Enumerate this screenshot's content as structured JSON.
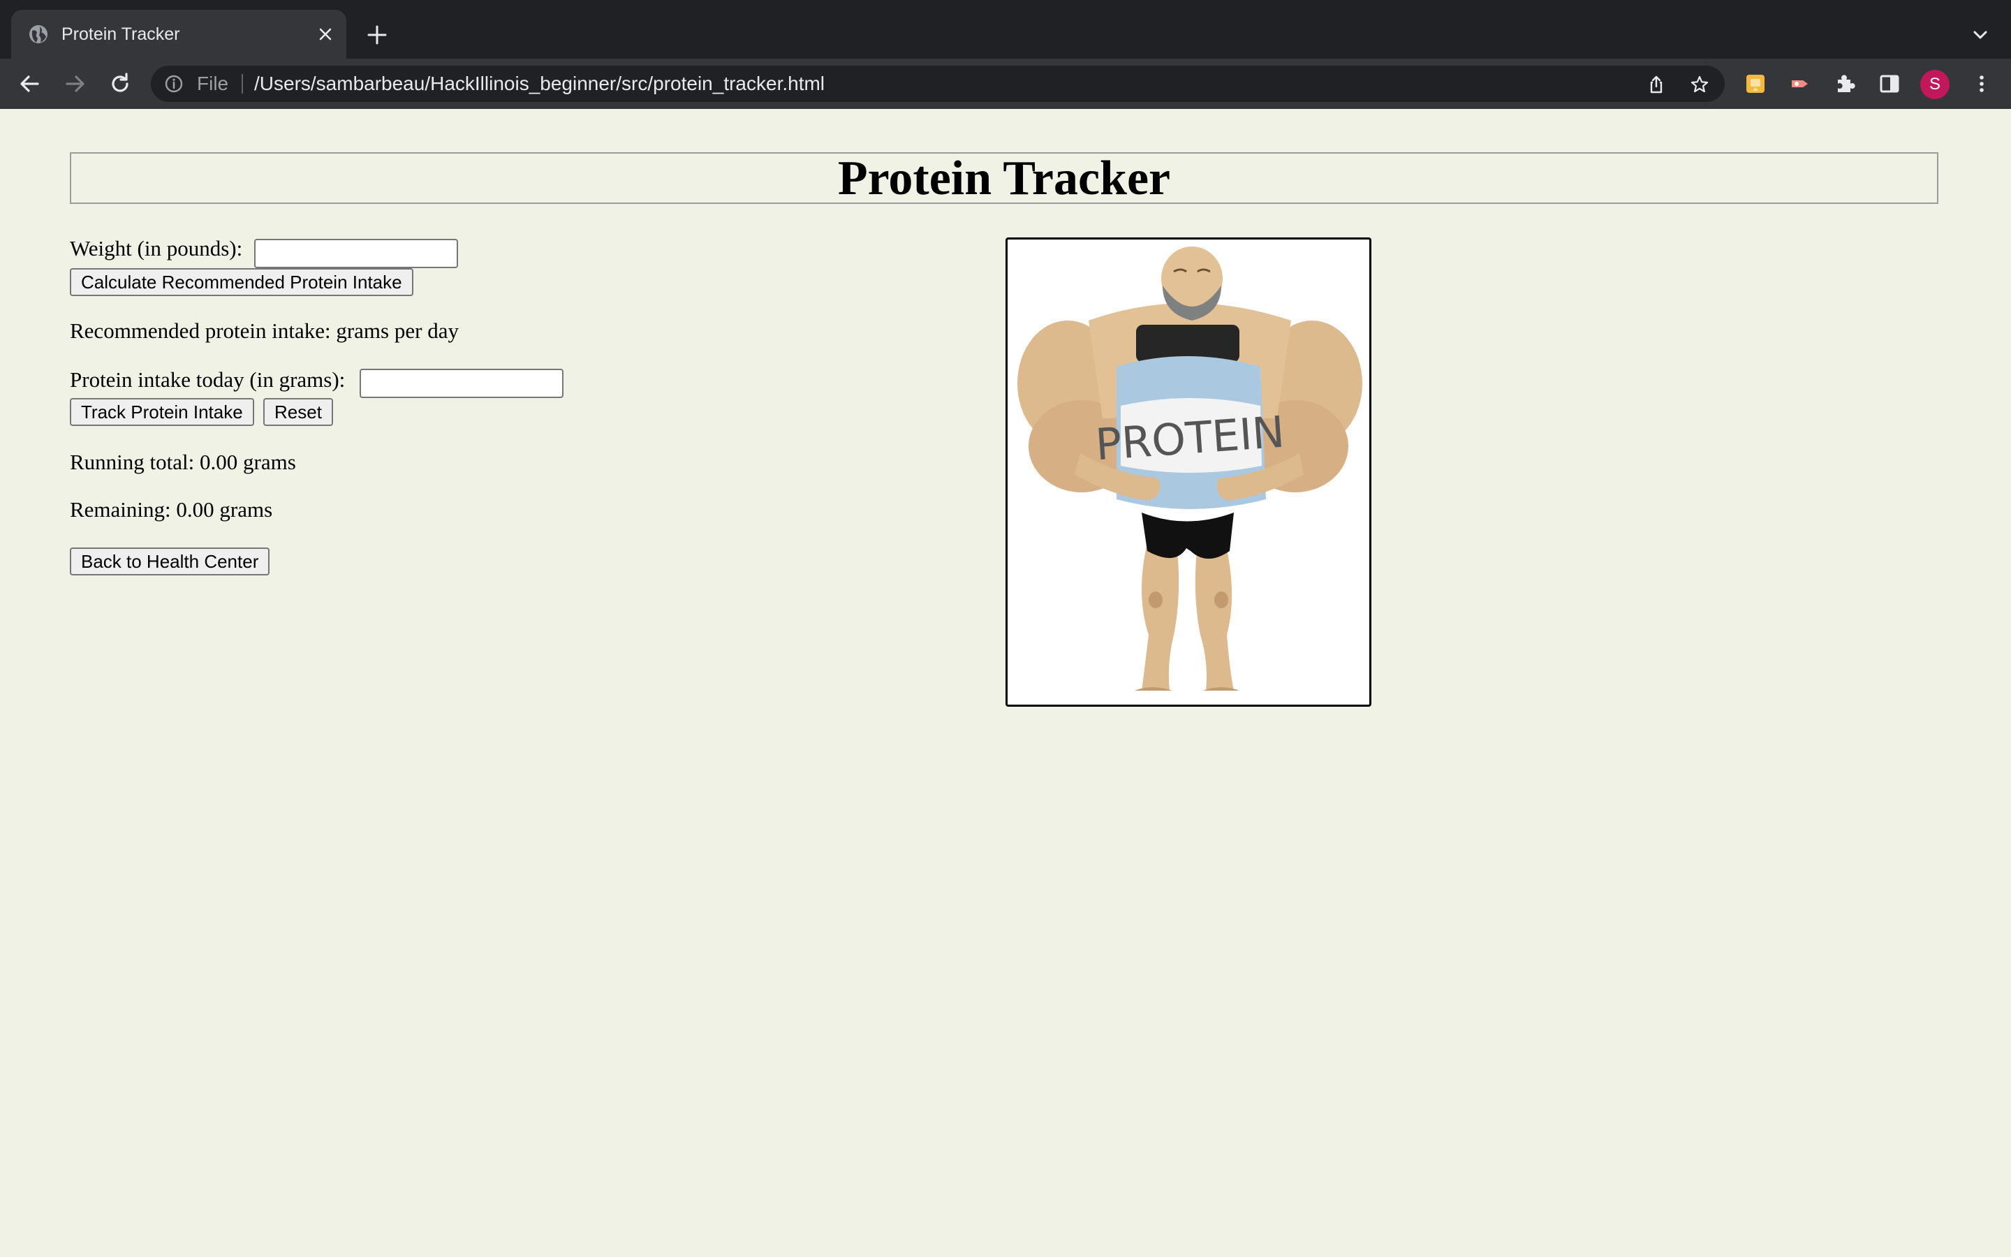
{
  "browser": {
    "tab_title": "Protein Tracker",
    "address_scheme": "File",
    "address_url": "/Users/sambarbeau/HackIllinois_beginner/src/protein_tracker.html",
    "profile_initial": "S",
    "icons": [
      "globe-icon",
      "close-icon",
      "plus-icon",
      "chevron-down-icon",
      "back-arrow-icon",
      "forward-arrow-icon",
      "reload-icon",
      "info-icon",
      "share-icon",
      "star-icon",
      "puzzle-icon",
      "side-panel-icon",
      "more-vertical-icon"
    ]
  },
  "page": {
    "title": "Protein Tracker",
    "weight_label": "Weight (in pounds):",
    "weight_value": "",
    "calculate_label": "Calculate Recommended Protein Intake",
    "recommended_text": "Recommended protein intake: grams per day",
    "intake_label": "Protein intake today (in grams):",
    "intake_value": "",
    "track_label": "Track Protein Intake",
    "reset_label": "Reset",
    "running_total_text": "Running total: 0.00 grams",
    "remaining_text": "Remaining: 0.00 grams",
    "back_label": "Back to Health Center",
    "illustration_text": "PROTEIN"
  },
  "colors": {
    "page_background": "#f1f2e6",
    "chrome_dark": "#202124",
    "chrome_toolbar": "#35363a",
    "profile_avatar": "#c2185b"
  }
}
